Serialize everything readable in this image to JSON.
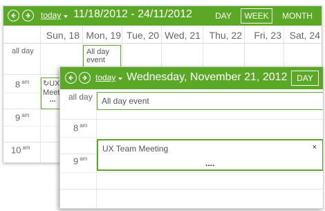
{
  "week_view": {
    "today_label": "today",
    "date_range": "11/18/2012 - 24/11/2012",
    "views": {
      "day": "DAY",
      "week": "WEEK",
      "month": "MONTH"
    },
    "active_view": "WEEK",
    "days": [
      "Sun, 18",
      "Mon, 19",
      "Tue, 20",
      "Wed, 21",
      "Thu, 22",
      "Fri, 23",
      "Sat, 24"
    ],
    "all_day_label": "all day",
    "all_day_event": {
      "title_line1": "All day",
      "title_line2": "event"
    },
    "times": [
      {
        "hour": "8",
        "suffix": "am"
      },
      {
        "hour": "9",
        "suffix": "am"
      },
      {
        "hour": "10",
        "suffix": "am"
      }
    ],
    "meeting_event": {
      "title": "UX",
      "line2": "Meet",
      "dots": "..."
    }
  },
  "day_view": {
    "today_label": "today",
    "date_title": "Wednesday, November 21, 2012",
    "view_button": "DAY",
    "all_day_label": "all day",
    "all_day_event": "All day event",
    "times": [
      {
        "hour": "8",
        "suffix": "am"
      },
      {
        "hour": "9",
        "suffix": "am"
      }
    ],
    "meeting_event": {
      "title": "UX Team Meeting",
      "close": "×",
      "dots": "...."
    }
  },
  "colors": {
    "accent": "#5aa826",
    "text": "#555555",
    "grid": "#e3e3e3"
  }
}
